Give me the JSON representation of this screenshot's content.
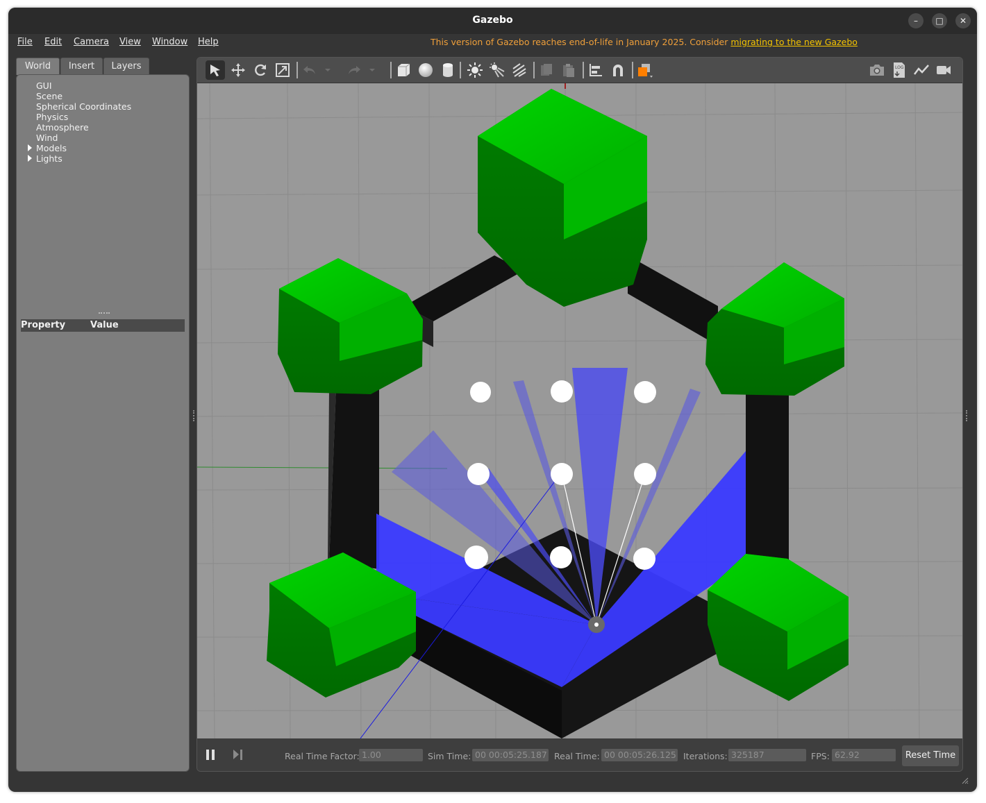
{
  "window": {
    "title": "Gazebo",
    "buttons": [
      "–",
      "□",
      "✕"
    ]
  },
  "menu": [
    "File",
    "Edit",
    "Camera",
    "View",
    "Window",
    "Help"
  ],
  "eol_notice": {
    "text": "This version of Gazebo reaches end-of-life in January 2025. Consider ",
    "link": "migrating to the new Gazebo"
  },
  "left_tabs": [
    "World",
    "Insert",
    "Layers"
  ],
  "world_tree": [
    {
      "label": "GUI",
      "expandable": false
    },
    {
      "label": "Scene",
      "expandable": false
    },
    {
      "label": "Spherical Coordinates",
      "expandable": false
    },
    {
      "label": "Physics",
      "expandable": false
    },
    {
      "label": "Atmosphere",
      "expandable": false
    },
    {
      "label": "Wind",
      "expandable": false
    },
    {
      "label": "Models",
      "expandable": true
    },
    {
      "label": "Lights",
      "expandable": true
    }
  ],
  "property_table": {
    "col1": "Property",
    "col2": "Value"
  },
  "toolbar": {
    "left_icons": [
      "select-arrow-icon",
      "translate-icon",
      "rotate-icon",
      "scale-icon",
      "undo-icon",
      "undo-dropdown-icon",
      "redo-icon",
      "redo-dropdown-icon",
      "box-shape-icon",
      "sphere-shape-icon",
      "cylinder-shape-icon",
      "point-light-icon",
      "spot-light-icon",
      "directional-light-icon",
      "copy-icon",
      "paste-icon",
      "align-icon",
      "snap-icon",
      "view-angle-icon"
    ],
    "right_icons": [
      "screenshot-icon",
      "log-icon",
      "plot-icon",
      "record-video-icon"
    ],
    "log_label": "LOG"
  },
  "status": {
    "rtf_label": "Real Time Factor:",
    "rtf_value": "1.00",
    "sim_label": "Sim Time:",
    "sim_value": "00 00:05:25.187",
    "real_label": "Real Time:",
    "real_value": "00 00:05:26.125",
    "iter_label": "Iterations:",
    "iter_value": "325187",
    "fps_label": "FPS:",
    "fps_value": "62.92",
    "reset_label": "Reset Time"
  },
  "colors": {
    "eol_text": "#f0a03a",
    "eol_link": "#f5c400",
    "ground": "#999999",
    "pillar_green": "#00aa00",
    "wall_black": "#111111",
    "laser_blue": "#3a3aff"
  }
}
